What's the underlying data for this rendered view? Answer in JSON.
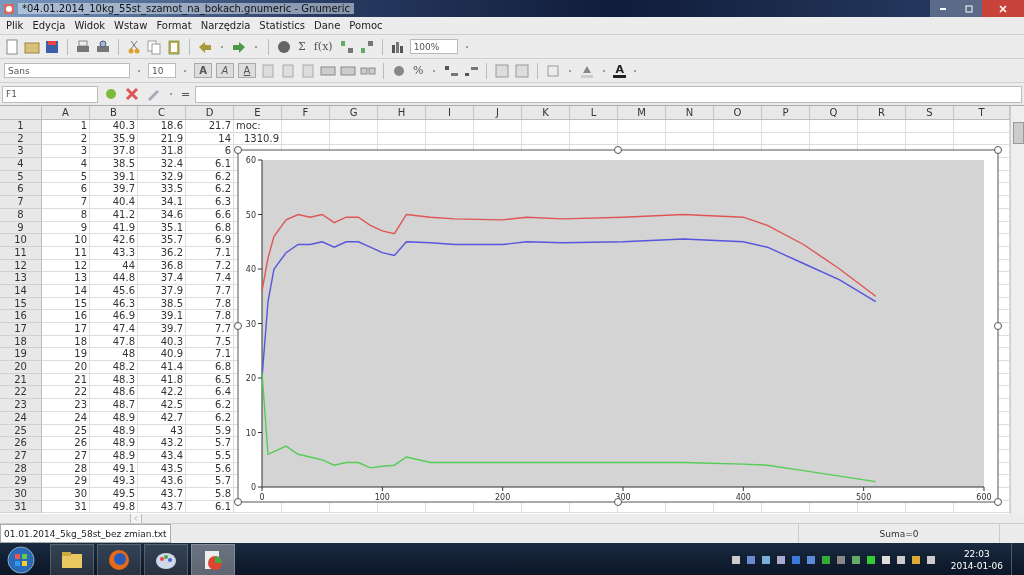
{
  "window": {
    "title": "*04.01.2014_10kg_55st_szamot_na_bokach.gnumeric - Gnumeric"
  },
  "menu": [
    "Plik",
    "Edycja",
    "Widok",
    "Wstaw",
    "Format",
    "Narzędzia",
    "Statistics",
    "Dane",
    "Pomoc"
  ],
  "toolbar": {
    "glyphs": [
      "Σ",
      "f(x)"
    ],
    "zoom": "100%"
  },
  "format_bar": {
    "font": "Sans",
    "size": "10",
    "style_buttons": [
      "A",
      "A",
      "A"
    ],
    "percent": "%",
    "font_color": "A"
  },
  "formula_bar": {
    "cell": "F1",
    "equals": "="
  },
  "sheet": {
    "columns": [
      "A",
      "B",
      "C",
      "D",
      "E",
      "F",
      "G",
      "H",
      "I",
      "J",
      "K",
      "L",
      "M",
      "N",
      "O",
      "P",
      "Q",
      "R",
      "S",
      "T"
    ],
    "rows": [
      {
        "number": "1",
        "cells": [
          "1",
          "40.3",
          "18.6",
          "21.7",
          {
            "text": "moc:",
            "kind": "label"
          }
        ]
      },
      {
        "number": "2",
        "cells": [
          "2",
          "35.9",
          "21.9",
          "14",
          "1310.9"
        ]
      },
      {
        "number": "3",
        "cells": [
          "3",
          "37.8",
          "31.8",
          "6"
        ]
      },
      {
        "number": "4",
        "cells": [
          "4",
          "38.5",
          "32.4",
          "6.1"
        ]
      },
      {
        "number": "5",
        "cells": [
          "5",
          "39.1",
          "32.9",
          "6.2"
        ]
      },
      {
        "number": "6",
        "cells": [
          "6",
          "39.7",
          "33.5",
          "6.2"
        ]
      },
      {
        "number": "7",
        "cells": [
          "7",
          "40.4",
          "34.1",
          "6.3"
        ]
      },
      {
        "number": "8",
        "cells": [
          "8",
          "41.2",
          "34.6",
          "6.6"
        ]
      },
      {
        "number": "9",
        "cells": [
          "9",
          "41.9",
          "35.1",
          "6.8"
        ]
      },
      {
        "number": "10",
        "cells": [
          "10",
          "42.6",
          "35.7",
          "6.9"
        ]
      },
      {
        "number": "11",
        "cells": [
          "11",
          "43.3",
          "36.2",
          "7.1"
        ]
      },
      {
        "number": "12",
        "cells": [
          "12",
          "44",
          "36.8",
          "7.2"
        ]
      },
      {
        "number": "13",
        "cells": [
          "13",
          "44.8",
          "37.4",
          "7.4"
        ]
      },
      {
        "number": "14",
        "cells": [
          "14",
          "45.6",
          "37.9",
          "7.7"
        ]
      },
      {
        "number": "15",
        "cells": [
          "15",
          "46.3",
          "38.5",
          "7.8"
        ]
      },
      {
        "number": "16",
        "cells": [
          "16",
          "46.9",
          "39.1",
          "7.8"
        ]
      },
      {
        "number": "17",
        "cells": [
          "17",
          "47.4",
          "39.7",
          "7.7"
        ]
      },
      {
        "number": "18",
        "cells": [
          "18",
          "47.8",
          "40.3",
          "7.5"
        ]
      },
      {
        "number": "19",
        "cells": [
          "19",
          "48",
          "40.9",
          "7.1"
        ]
      },
      {
        "number": "20",
        "cells": [
          "20",
          "48.2",
          "41.4",
          "6.8"
        ]
      },
      {
        "number": "21",
        "cells": [
          "21",
          "48.3",
          "41.8",
          "6.5"
        ]
      },
      {
        "number": "22",
        "cells": [
          "22",
          "48.6",
          "42.2",
          "6.4"
        ]
      },
      {
        "number": "23",
        "cells": [
          "23",
          "48.7",
          "42.5",
          "6.2"
        ]
      },
      {
        "number": "24",
        "cells": [
          "24",
          "48.9",
          "42.7",
          "6.2"
        ]
      },
      {
        "number": "25",
        "cells": [
          "25",
          "48.9",
          "43",
          "5.9"
        ]
      },
      {
        "number": "26",
        "cells": [
          "26",
          "48.9",
          "43.2",
          "5.7"
        ]
      },
      {
        "number": "27",
        "cells": [
          "27",
          "48.9",
          "43.4",
          "5.5"
        ]
      },
      {
        "number": "28",
        "cells": [
          "28",
          "49.1",
          "43.5",
          "5.6"
        ]
      },
      {
        "number": "29",
        "cells": [
          "29",
          "49.3",
          "43.6",
          "5.7"
        ]
      },
      {
        "number": "30",
        "cells": [
          "30",
          "49.5",
          "43.7",
          "5.8"
        ]
      },
      {
        "number": "31",
        "cells": [
          "31",
          "49.8",
          "43.7",
          "6.1"
        ]
      }
    ]
  },
  "chart": {
    "chart_data": {
      "type": "line",
      "x": [
        0,
        5,
        10,
        20,
        30,
        40,
        50,
        60,
        70,
        80,
        90,
        100,
        110,
        120,
        140,
        160,
        200,
        220,
        250,
        300,
        350,
        400,
        420,
        450,
        480,
        510
      ],
      "series": [
        {
          "color": "#e05555",
          "values": [
            36,
            42,
            46,
            49,
            50,
            49.5,
            50,
            48.5,
            49.5,
            49.5,
            48,
            47,
            46.5,
            50,
            49.5,
            49.2,
            49,
            49.5,
            49.2,
            49.5,
            50,
            49.5,
            48,
            44.5,
            40,
            35
          ]
        },
        {
          "color": "#5555dd",
          "values": [
            20,
            34,
            40,
            43,
            44.5,
            44.5,
            45,
            44,
            45,
            45,
            44,
            43,
            42.5,
            45,
            44.8,
            44.5,
            44.5,
            45,
            44.8,
            45,
            45.5,
            45,
            44,
            41,
            38,
            34
          ]
        },
        {
          "color": "#55cc55",
          "values": [
            21,
            6,
            6.5,
            7.5,
            6,
            5.5,
            5,
            4,
            4.5,
            4.5,
            3.5,
            3.8,
            4,
            5.5,
            4.5,
            4.5,
            4.5,
            4.5,
            4.5,
            4.5,
            4.5,
            4.2,
            4,
            3,
            2,
            1
          ]
        }
      ],
      "xlim": [
        0,
        600
      ],
      "ylim": [
        0,
        60
      ],
      "xticks": [
        0,
        100,
        200,
        300,
        400,
        500,
        600
      ],
      "yticks": [
        0,
        10,
        20,
        30,
        40,
        50,
        60
      ]
    }
  },
  "sheet_tab": {
    "label": "01.01.2014_5kg_58st_bez zmian.txt",
    "selected": true
  },
  "status_bar": {
    "sum": "Suma=0"
  },
  "taskbar": {
    "time": "22:03",
    "date": "2014-01-06"
  }
}
